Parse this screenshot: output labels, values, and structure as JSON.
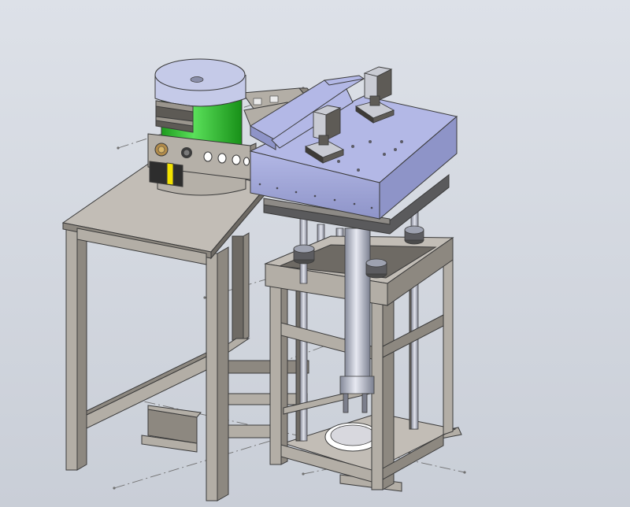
{
  "view": {
    "background": "#d3d7df",
    "edge_color": "#3a3a3a",
    "centerline_color": "#707070"
  },
  "materials": {
    "steel_frame": "#b3aea6",
    "steel_frame_shadow": "#8d8880",
    "steel_frame_dark": "#6e6a64",
    "tabletop": "#c2bdb6",
    "enclosure_box": "#b3b8e6",
    "enclosure_box_dark": "#8e94c8",
    "rotary_table_body": "#32c832",
    "rotary_table_disk": "#c5cae8",
    "bracket_plate": "#b5b0a8",
    "warning_label": "#f2e200",
    "stepper_motor": "#c9cbd3",
    "stepper_motor_dark": "#5e5b56",
    "guide_rod": "#a4a7b4",
    "cylinder": "#b4b8c6"
  },
  "icons": {
    "rotary_table": "rotary-table-icon",
    "stepper_motor": "stepper-motor-icon"
  }
}
